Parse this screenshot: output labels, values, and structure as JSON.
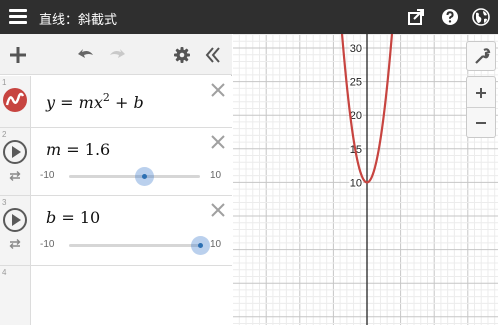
{
  "header": {
    "title": "直线：斜截式",
    "icons": [
      "menu-icon",
      "share-icon",
      "help-icon",
      "globe-icon"
    ]
  },
  "toolbar": {
    "icons": [
      "add-icon",
      "undo-icon",
      "redo-icon",
      "gear-icon",
      "collapse-icon"
    ]
  },
  "expressions": [
    {
      "index": "1",
      "lhs": "y",
      "eq": "=",
      "m": "m",
      "x": "x",
      "exponent": "2",
      "plus": "+",
      "b": "b",
      "color": "#c74440"
    },
    {
      "index": "2",
      "variable": "m",
      "eq": "=",
      "value": "1.6",
      "slider": {
        "min": "-10",
        "max": "10",
        "value": 1.6
      }
    },
    {
      "index": "3",
      "variable": "b",
      "eq": "=",
      "value": "10",
      "slider": {
        "min": "-10",
        "max": "10",
        "value": 10
      }
    },
    {
      "index": "4"
    }
  ],
  "graph": {
    "y_tick_labels": [
      "30",
      "25",
      "20",
      "15",
      "10"
    ],
    "curve": {
      "m": 1.6,
      "b": 10,
      "color": "#c74440"
    },
    "buttons": [
      "wrench-icon",
      "zoom-in-icon",
      "zoom-out-icon"
    ]
  }
}
